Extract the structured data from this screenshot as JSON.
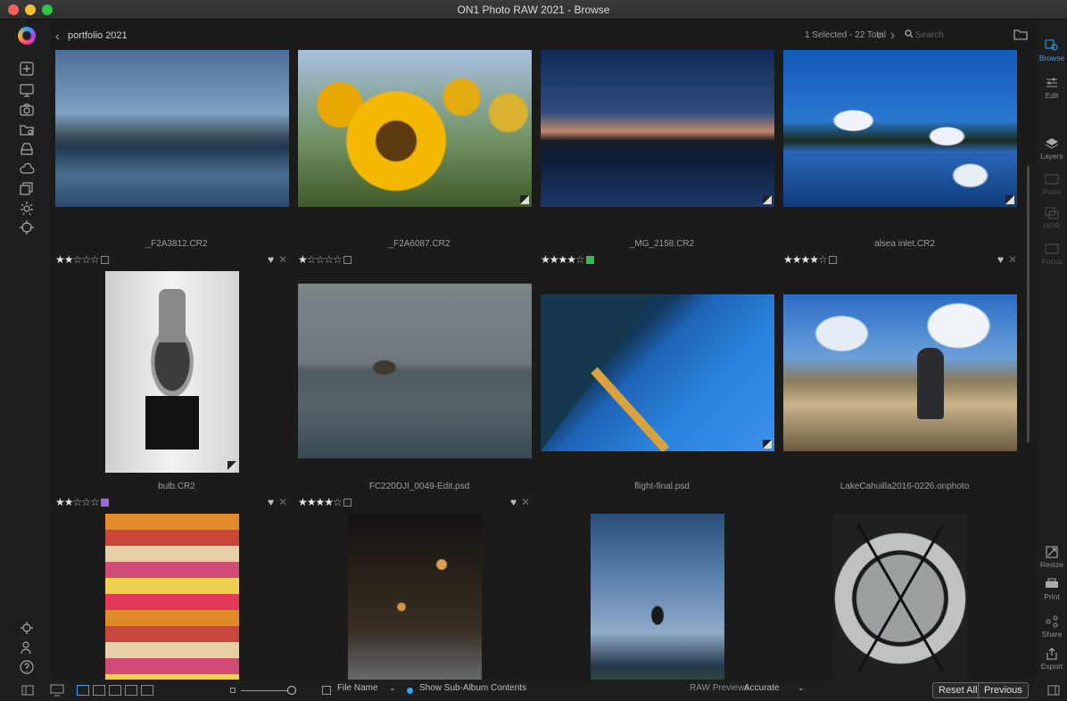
{
  "window": {
    "title": "ON1 Photo RAW 2021 - Browse"
  },
  "topbar": {
    "breadcrumb": "portfolio 2021",
    "selection_info": "1 Selected - 22 Total",
    "search_placeholder": "Search"
  },
  "photos": [
    {
      "filename": "_F2A3812.CR2",
      "rating": 2,
      "heart": false,
      "label": "none"
    },
    {
      "filename": "_F2A6087.CR2",
      "rating": 1,
      "heart": true,
      "label": "none"
    },
    {
      "filename": "_MG_2158.CR2",
      "rating": 4,
      "heart": false,
      "label": "green"
    },
    {
      "filename": "alsea inlet.CR2",
      "rating": 4,
      "heart": false,
      "label": "none"
    },
    {
      "filename": "bulb.CR2",
      "rating": 2,
      "heart": false,
      "label": "purple"
    },
    {
      "filename": "FC220DJI_0049-Edit.psd",
      "rating": 4,
      "heart": true,
      "label": "none"
    },
    {
      "filename": "flight-final.psd",
      "rating": 0,
      "heart": true,
      "label": "none"
    },
    {
      "filename": "LakeCahuilla2016-0226.onphoto",
      "rating": 0,
      "heart": false,
      "label": "none"
    }
  ],
  "right_modules": {
    "browse": "Browse",
    "edit": "Edit",
    "layers": "Layers",
    "pano": "Pano",
    "hdr": "HDR",
    "focus": "Focus",
    "resize": "Resize",
    "print": "Print",
    "share": "Share",
    "export": "Export"
  },
  "bottombar": {
    "sort_label": "File Name",
    "show_sub_album": "Show Sub-Album Contents",
    "raw_previews_label": "RAW Previews",
    "raw_previews_value": "Accurate",
    "reset_all": "Reset All",
    "previous": "Previous"
  },
  "colors": {
    "accent": "#2aa8ff",
    "label_green": "#2fbf4a",
    "label_purple": "#9a6ad8"
  }
}
